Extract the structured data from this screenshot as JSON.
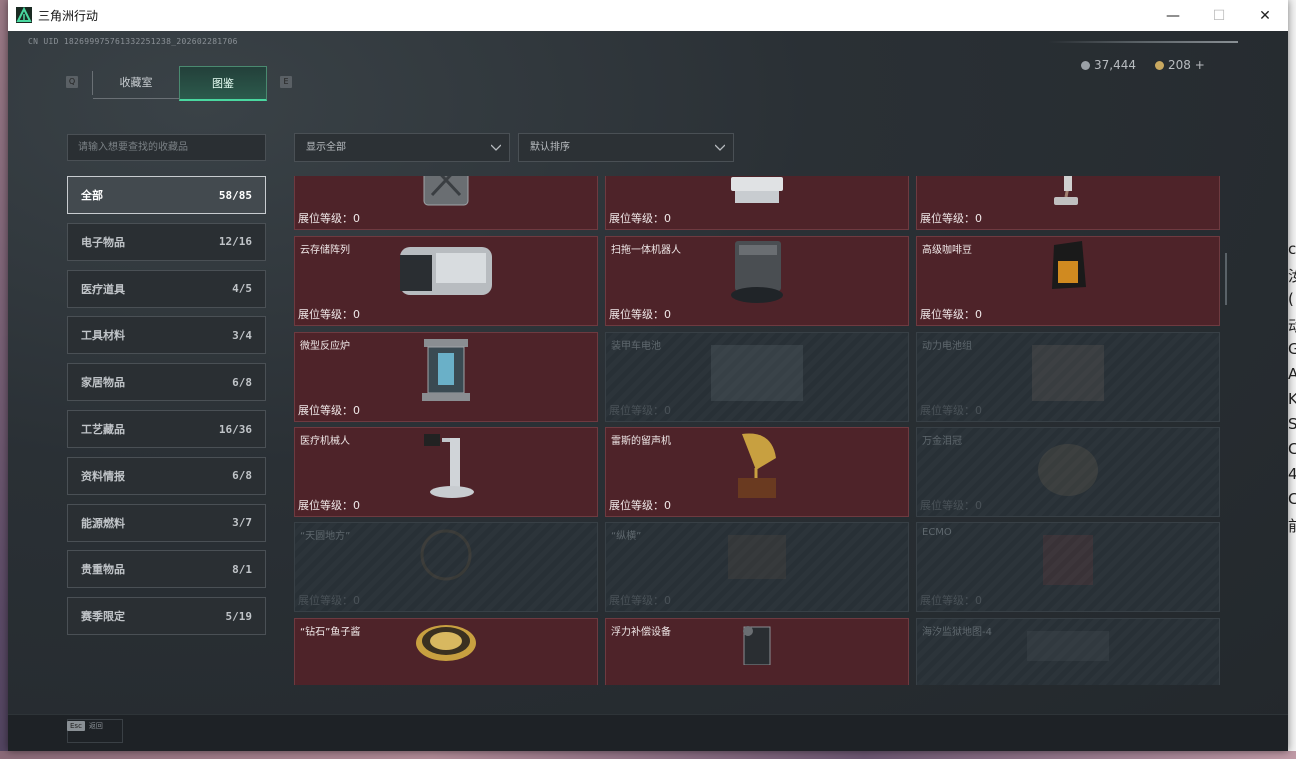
{
  "window": {
    "title": "三角洲行动",
    "minimize": "—",
    "maximize": "☐",
    "close": "✕"
  },
  "header": {
    "uid": "CN UID 1826999757613322512​38_202602281706",
    "currency_1": "37,444",
    "currency_2": "208 +",
    "key_left": "Q",
    "key_right": "E",
    "tabs": [
      {
        "label": "收藏室"
      },
      {
        "label": "图鉴"
      }
    ]
  },
  "search": {
    "placeholder": "请输入想要查找的收藏品"
  },
  "filters": {
    "show": "显示全部",
    "sort": "默认排序"
  },
  "categories": [
    {
      "label": "全部",
      "count": "58/85"
    },
    {
      "label": "电子物品",
      "count": "12/16"
    },
    {
      "label": "医疗道具",
      "count": "4/5"
    },
    {
      "label": "工具材料",
      "count": "3/4"
    },
    {
      "label": "家居物品",
      "count": "6/8"
    },
    {
      "label": "工艺藏品",
      "count": "16/36"
    },
    {
      "label": "资料情报",
      "count": "6/8"
    },
    {
      "label": "能源燃料",
      "count": "3/7"
    },
    {
      "label": "贵重物品",
      "count": "8/1"
    },
    {
      "label": "赛季限定",
      "count": "5/19"
    }
  ],
  "items": [
    {
      "name": "",
      "level": "展位等级：0",
      "owned": true,
      "icon": "jerrycan-icon"
    },
    {
      "name": "",
      "level": "展位等级：0",
      "owned": true,
      "icon": "ultrasound-device-icon"
    },
    {
      "name": "",
      "level": "展位等级：0",
      "owned": true,
      "icon": "vacuum-cleaner-icon"
    },
    {
      "name": "云存储阵列",
      "level": "展位等级：0",
      "owned": true,
      "icon": "storage-array-icon"
    },
    {
      "name": "扫拖一体机器人",
      "level": "展位等级：0",
      "owned": true,
      "icon": "mop-robot-icon"
    },
    {
      "name": "高级咖啡豆",
      "level": "展位等级：0",
      "owned": true,
      "icon": "coffee-bag-icon"
    },
    {
      "name": "微型反应炉",
      "level": "展位等级：0",
      "owned": true,
      "icon": "reactor-icon"
    },
    {
      "name": "装甲车电池",
      "level": "展位等级：0",
      "owned": false,
      "icon": "battery-icon"
    },
    {
      "name": "动力电池组",
      "level": "展位等级：0",
      "owned": false,
      "icon": "battery-pack-icon"
    },
    {
      "name": "医疗机械人",
      "level": "展位等级：0",
      "owned": true,
      "icon": "medical-robot-icon"
    },
    {
      "name": "雷斯的留声机",
      "level": "展位等级：0",
      "owned": true,
      "icon": "gramophone-icon"
    },
    {
      "name": "万金泪冠",
      "level": "展位等级：0",
      "owned": false,
      "icon": "crown-icon"
    },
    {
      "name": "“天圆地方”",
      "level": "展位等级：0",
      "owned": false,
      "icon": "globe-icon"
    },
    {
      "name": "“纵横”",
      "level": "展位等级：0",
      "owned": false,
      "icon": "board-icon"
    },
    {
      "name": "ECMO",
      "level": "展位等级：0",
      "owned": false,
      "icon": "ecmo-icon"
    },
    {
      "name": "“钻石”鱼子酱",
      "level": "",
      "owned": true,
      "icon": "caviar-tin-icon"
    },
    {
      "name": "浮力补偿设备",
      "level": "",
      "owned": true,
      "icon": "bcd-icon"
    },
    {
      "name": "海汐监狱地图-4",
      "level": "",
      "owned": false,
      "icon": "map-icon"
    }
  ],
  "footer": {
    "esc_key": "Esc",
    "esc_label": "返回"
  },
  "colors": {
    "accent": "#4ad8a0",
    "owned_card": "#4e2329",
    "panel": "#24292d"
  }
}
